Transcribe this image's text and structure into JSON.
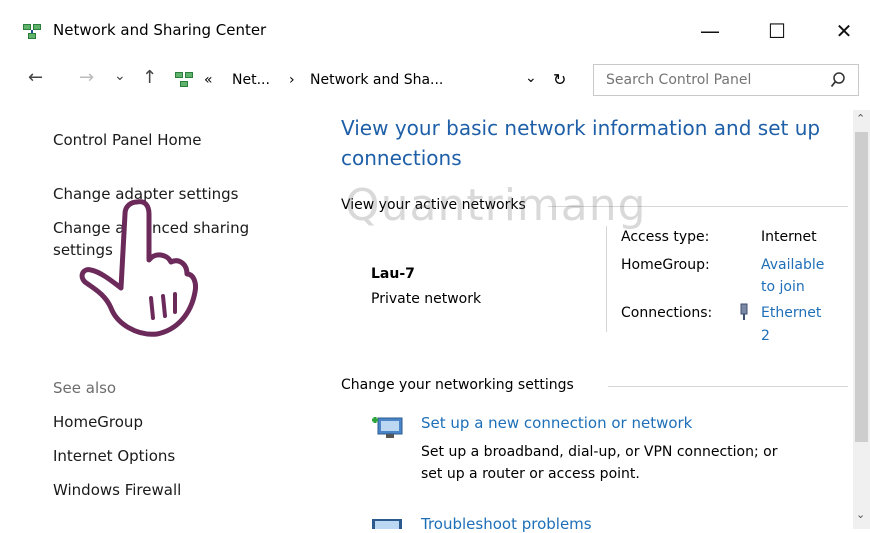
{
  "window": {
    "title": "Network and Sharing Center",
    "minimize_glyph": "—",
    "maximize_glyph": "☐",
    "close_glyph": "✕"
  },
  "nav": {
    "back_glyph": "←",
    "forward_glyph": "→",
    "recent_glyph": "⌄",
    "up_glyph": "↑",
    "overflow": "«",
    "crumb1": "Net...",
    "sep": "›",
    "crumb2": "Network and Sha...",
    "dropdown_glyph": "⌄",
    "refresh_glyph": "↻",
    "search_placeholder": "Search Control Panel"
  },
  "left": {
    "home": "Control Panel Home",
    "adapter": "Change adapter settings",
    "advanced_line1": "Change advanced sharing",
    "advanced_line2": "settings",
    "see_also": "See also",
    "see_items": [
      "HomeGroup",
      "Internet Options",
      "Windows Firewall"
    ]
  },
  "main": {
    "heading_line1": "View your basic network information and set up",
    "heading_line2": "connections",
    "active_networks": "View your active networks",
    "network_name": "Lau-7",
    "network_type": "Private network",
    "access_type_label": "Access type:",
    "access_type_value": "Internet",
    "homegroup_label": "HomeGroup:",
    "homegroup_line1": "Available",
    "homegroup_line2": "to join",
    "connections_label": "Connections:",
    "connections_line1": "Ethernet",
    "connections_line2": "2",
    "change_settings": "Change your networking settings",
    "setup_link": "Set up a new connection or network",
    "setup_desc1": "Set up a broadband, dial-up, or VPN connection; or",
    "setup_desc2": "set up a router or access point.",
    "troubleshoot_link": "Troubleshoot problems"
  },
  "watermark": "Quantrimang",
  "colors": {
    "link": "#1e6fb8",
    "heading": "#1e5fa8",
    "hand": "#6b2a5a"
  },
  "icons": {
    "app": "network-icon",
    "search": "search-icon",
    "ethernet": "ethernet-icon",
    "setup": "new-connection-icon",
    "troubleshoot": "troubleshoot-icon"
  }
}
